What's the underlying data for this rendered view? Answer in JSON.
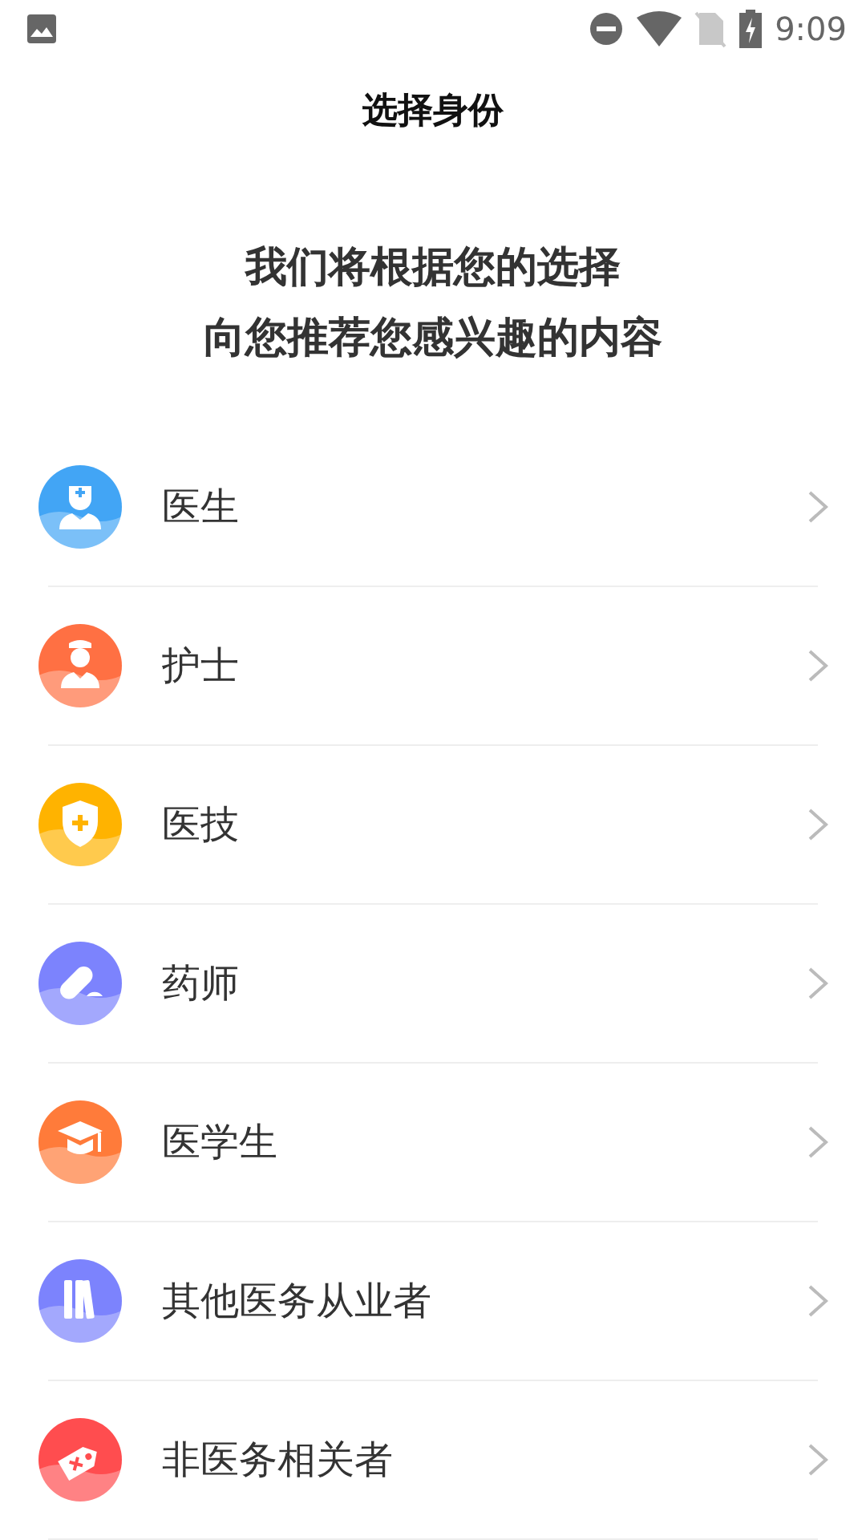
{
  "status_bar": {
    "time": "9:09"
  },
  "title": "选择身份",
  "subtitle": [
    "我们将根据您的选择",
    "向您推荐您感兴趣的内容"
  ],
  "items": [
    {
      "label": "医生",
      "kind": "doctor",
      "color": "#42a5f5"
    },
    {
      "label": "护士",
      "kind": "nurse",
      "color": "#ff7043"
    },
    {
      "label": "医技",
      "kind": "shield",
      "color": "#ffb300"
    },
    {
      "label": "药师",
      "kind": "pill",
      "color": "#7c83fd"
    },
    {
      "label": "医学生",
      "kind": "graduate",
      "color": "#ff7b3a"
    },
    {
      "label": "其他医务从业者",
      "kind": "books",
      "color": "#7c83fd"
    },
    {
      "label": "非医务相关者",
      "kind": "tag",
      "color": "#ff4d4f"
    }
  ]
}
